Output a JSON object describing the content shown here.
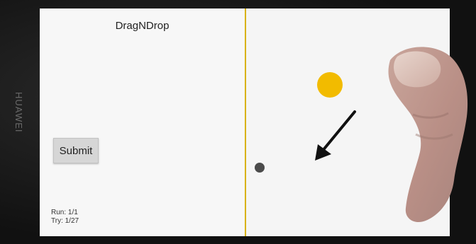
{
  "device": {
    "brand_label": "HUAWEI"
  },
  "app": {
    "title": "DragNDrop",
    "submit_label": "Submit",
    "run_text": "Run: 1/1",
    "try_text": "Try: 1/27"
  },
  "colors": {
    "divider": "#d8b200",
    "drag_circle": "#f2bb00",
    "target_dot": "#4b4b4b"
  },
  "icons": {
    "arrow": "arrow-down-left-icon"
  }
}
